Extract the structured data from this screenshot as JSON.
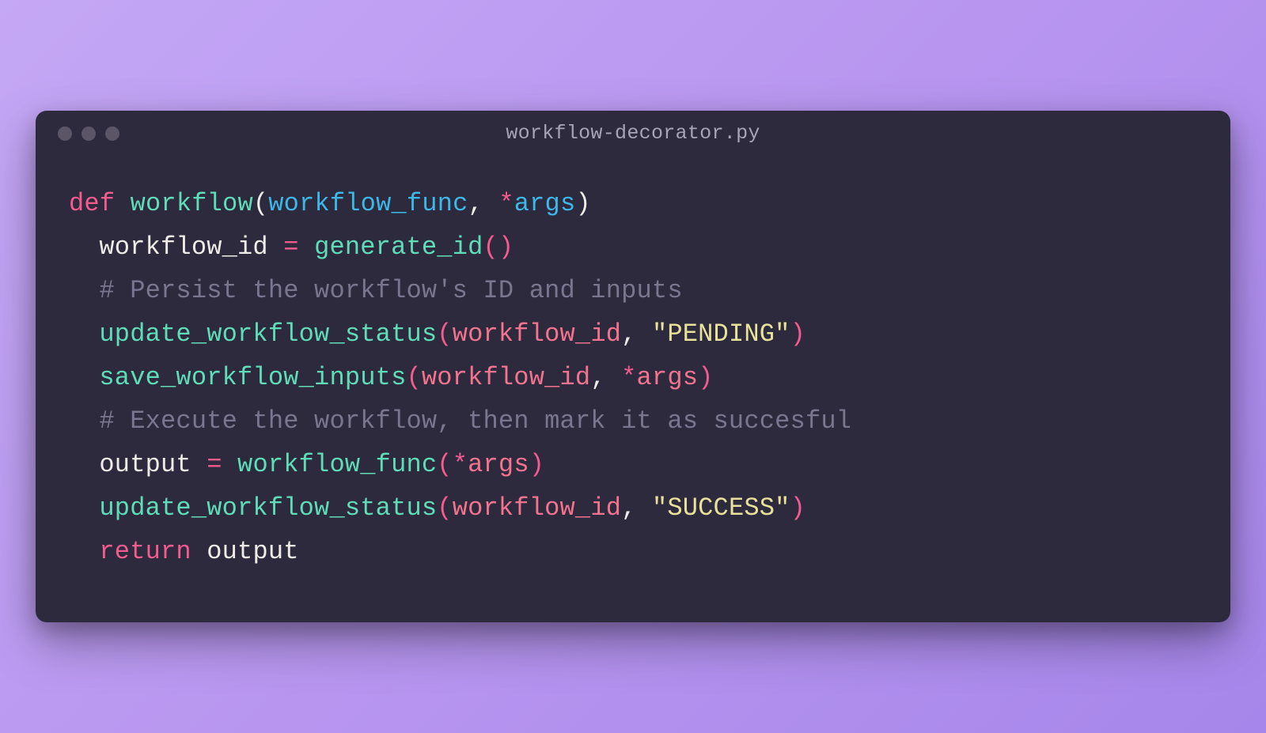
{
  "titlebar": {
    "filename": "workflow-decorator.py"
  },
  "code": {
    "line1": {
      "def": "def",
      "funcname": "workflow",
      "lparen": "(",
      "param1": "workflow_func",
      "comma": ", ",
      "star": "*",
      "param2": "args",
      "rparen": ")"
    },
    "line2": {
      "var": "workflow_id",
      "eq": " = ",
      "func": "generate_id",
      "parens": "()"
    },
    "line3": {
      "comment": "# Persist the workflow's ID and inputs"
    },
    "line4": {
      "func": "update_workflow_status",
      "lparen": "(",
      "arg1": "workflow_id",
      "comma": ", ",
      "str": "\"PENDING\"",
      "rparen": ")"
    },
    "line5": {
      "func": "save_workflow_inputs",
      "lparen": "(",
      "arg1": "workflow_id",
      "comma": ", ",
      "star": "*",
      "arg2": "args",
      "rparen": ")"
    },
    "line6": {
      "comment": "# Execute the workflow, then mark it as succesful"
    },
    "line7": {
      "var": "output",
      "eq": " = ",
      "func": "workflow_func",
      "lparen": "(",
      "star": "*",
      "arg": "args",
      "rparen": ")"
    },
    "line8": {
      "func": "update_workflow_status",
      "lparen": "(",
      "arg1": "workflow_id",
      "comma": ", ",
      "str": "\"SUCCESS\"",
      "rparen": ")"
    },
    "line9": {
      "return": "return",
      "space": " ",
      "var": "output"
    }
  }
}
